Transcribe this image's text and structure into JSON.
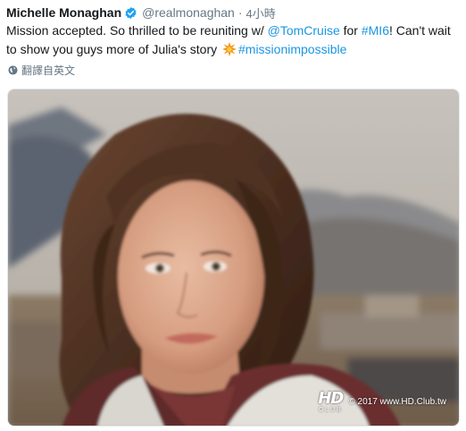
{
  "tweet": {
    "author_name": "Michelle Monaghan",
    "handle": "@realmonaghan",
    "separator": "·",
    "time": "4小時",
    "text": {
      "part1": "Mission accepted. So thrilled to be reuniting w/ ",
      "mention": "@TomCruise",
      "part2": " for ",
      "hashtag1": "#MI6",
      "part3": "! Can't wait to show you guys more of Julia's story ",
      "emoji": "collision-emoji",
      "hashtag2": "#missionimpossible"
    },
    "translate_label": "翻譯自英文",
    "icons": {
      "verified": "verified-badge-icon",
      "globe": "globe-icon"
    }
  },
  "watermark": {
    "logo_top": "HD",
    "logo_bottom": "CLUB",
    "text": "© 2017 www.HD.Club.tw"
  },
  "colors": {
    "link": "#1b95e0",
    "verified": "#1da1f2",
    "secondary_text": "#657786"
  }
}
